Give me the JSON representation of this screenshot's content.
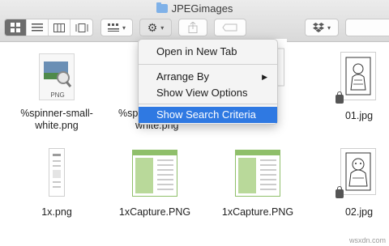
{
  "window": {
    "title": "JPEGimages"
  },
  "toolbar": {
    "view_buttons": [
      "icon-view",
      "list-view",
      "column-view",
      "gallery-view"
    ],
    "group_icon": "group-grid-icon",
    "action_icon": "gear-icon",
    "share_icon": "share-icon",
    "tag_icon": "tag-icon",
    "dropbox_icon": "dropbox-icon"
  },
  "menu": {
    "items": [
      {
        "label": "Open in New Tab"
      },
      {
        "label": "Arrange By"
      },
      {
        "label": "Show View Options"
      },
      {
        "label": "Show Search Criteria"
      }
    ],
    "selected": "Show Search Criteria"
  },
  "files": {
    "row1": [
      {
        "line1": "%spinner-small-",
        "line2": "white.png"
      },
      {
        "line1": "%sp",
        "line2": "white.png"
      },
      {
        "line1": "01.jpg",
        "line2": ""
      }
    ],
    "row2": [
      {
        "label": "1x.png"
      },
      {
        "label": "1xCapture.PNG"
      },
      {
        "label": "1xCapture.PNG"
      },
      {
        "label": "02.jpg"
      }
    ],
    "png_badge": "PNG"
  },
  "watermark": "wsxdn.com",
  "colors": {
    "selection": "#2f79e2",
    "folder": "#7fb1e8",
    "capture_green": "#8fbf6a"
  }
}
